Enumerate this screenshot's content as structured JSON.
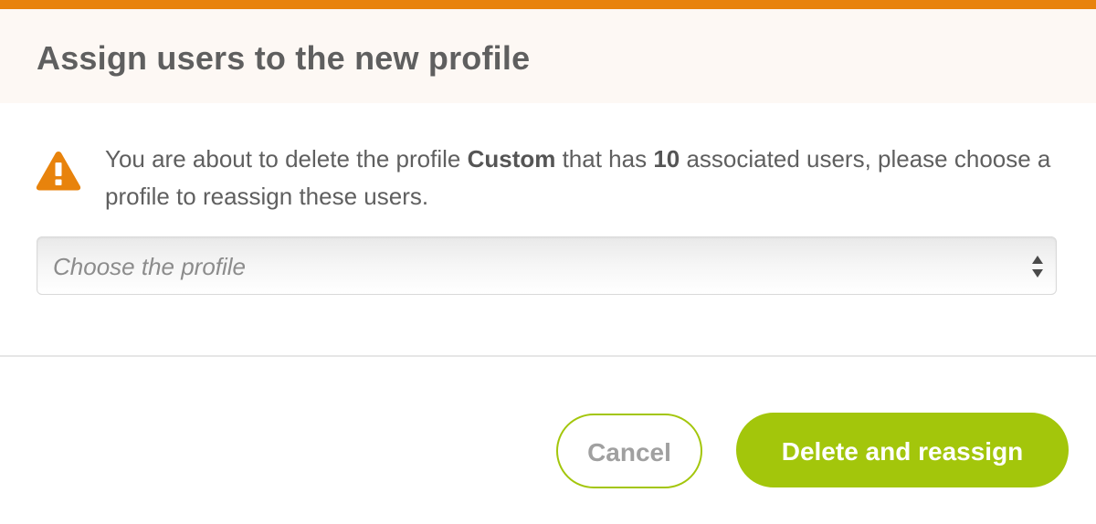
{
  "dialog": {
    "title": "Assign users to the new profile",
    "message": {
      "part1": "You are about to delete the profile ",
      "profile_name": "Custom",
      "part2": " that has ",
      "user_count": "10",
      "part3": " associated users, please choose a profile to reassign these users."
    },
    "select": {
      "placeholder": "Choose the profile"
    },
    "buttons": {
      "cancel_label": "Cancel",
      "confirm_label": "Delete and reassign"
    },
    "icons": {
      "warning": "warning-icon",
      "select_arrows": "up-down-arrows-icon"
    },
    "colors": {
      "accent_orange": "#e8830c",
      "header_bg": "#fdf8f4",
      "primary_green": "#a3c60b",
      "text": "#5f5f5f"
    }
  }
}
